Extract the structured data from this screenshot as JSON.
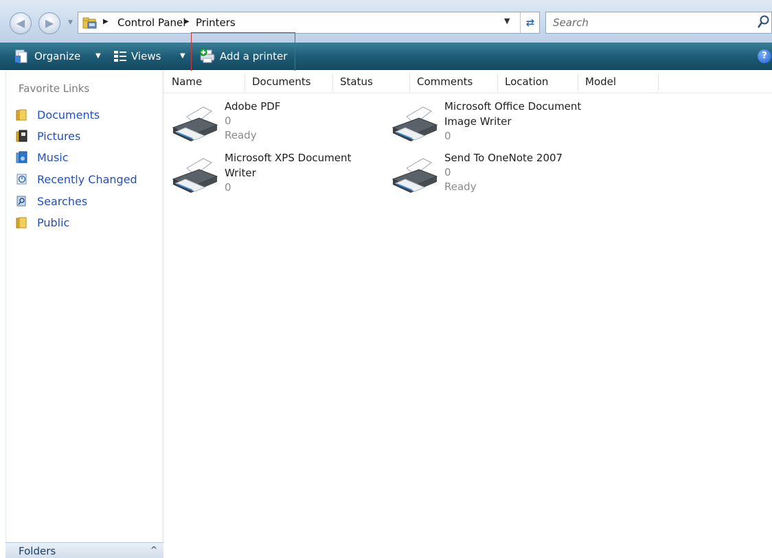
{
  "address_bar": {
    "breadcrumb": [
      "Control Panel",
      "Printers"
    ],
    "search_placeholder": "Search"
  },
  "toolbar": {
    "organize": "Organize",
    "views": "Views",
    "add_printer": "Add a printer",
    "help": "?"
  },
  "left_nav": {
    "title": "Favorite Links",
    "items": [
      {
        "label": "Documents",
        "icon": "folder-icon"
      },
      {
        "label": "Pictures",
        "icon": "pictures-icon"
      },
      {
        "label": "Music",
        "icon": "music-icon"
      },
      {
        "label": "Recently Changed",
        "icon": "recent-icon"
      },
      {
        "label": "Searches",
        "icon": "searches-icon"
      },
      {
        "label": "Public",
        "icon": "folder-icon"
      }
    ],
    "folders_label": "Folders"
  },
  "columns": [
    "Name",
    "Documents",
    "Status",
    "Comments",
    "Location",
    "Model"
  ],
  "printers": [
    {
      "name_line1": "Adobe PDF",
      "name_line2": "",
      "documents": "0",
      "status": "Ready"
    },
    {
      "name_line1": "Microsoft Office Document",
      "name_line2": "Image Writer",
      "documents": "0",
      "status": ""
    },
    {
      "name_line1": "Microsoft XPS Document",
      "name_line2": "Writer",
      "documents": "0",
      "status": ""
    },
    {
      "name_line1": "Send To OneNote 2007",
      "name_line2": "",
      "documents": "0",
      "status": "Ready"
    }
  ],
  "colors": {
    "toolbar": "#1d5a74",
    "link": "#1f4fc2",
    "highlight_box": "#d23a3a"
  }
}
